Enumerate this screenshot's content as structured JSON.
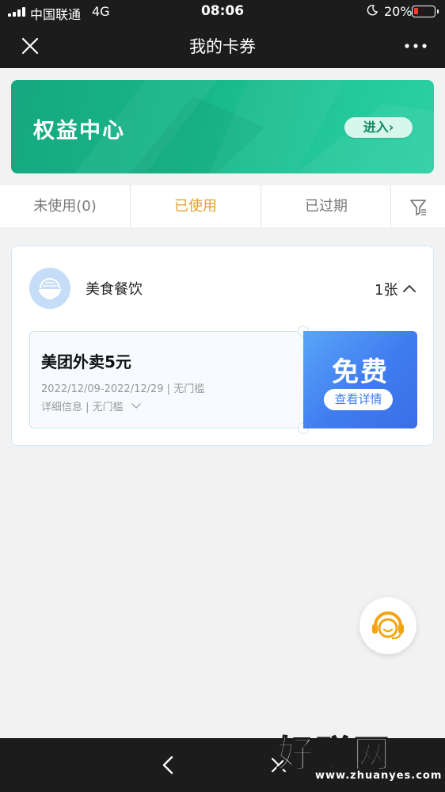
{
  "status_bar": {
    "carrier": "中国联通",
    "network": "4G",
    "time": "08:06",
    "battery_percent": "20%",
    "battery_level": 0.2,
    "battery_color": "#ff3b30"
  },
  "nav": {
    "title": "我的卡券",
    "close_icon": "close-icon",
    "more_icon": "more-icon"
  },
  "banner": {
    "title": "权益中心",
    "button_label": "进入›",
    "colors": [
      "#16a77f",
      "#2bd0a4"
    ]
  },
  "tabs": [
    {
      "label": "未使用(0)",
      "active": false
    },
    {
      "label": "已使用",
      "active": true
    },
    {
      "label": "已过期",
      "active": false
    }
  ],
  "accent_color": "#e3a12a",
  "filter_icon": "filter-icon",
  "group": {
    "name": "美食餐饮",
    "count": "1张",
    "icon": "bowl-icon",
    "expanded": true,
    "coupon": {
      "name": "美团外卖5元",
      "date_range": "2022/12/09-2022/12/29 | 无门槛",
      "detail_label": "详细信息 | 无门槛",
      "price_label": "免费",
      "view_label": "查看详情",
      "color": "#3f7cf0"
    }
  },
  "service_icon": "customer-service-icon",
  "bottom_bar": {
    "back_icon": "back-arrow-icon",
    "close_icon": "close-icon",
    "watermark_main": "好赚网",
    "watermark_sub": "www.zhuanyes.com"
  }
}
